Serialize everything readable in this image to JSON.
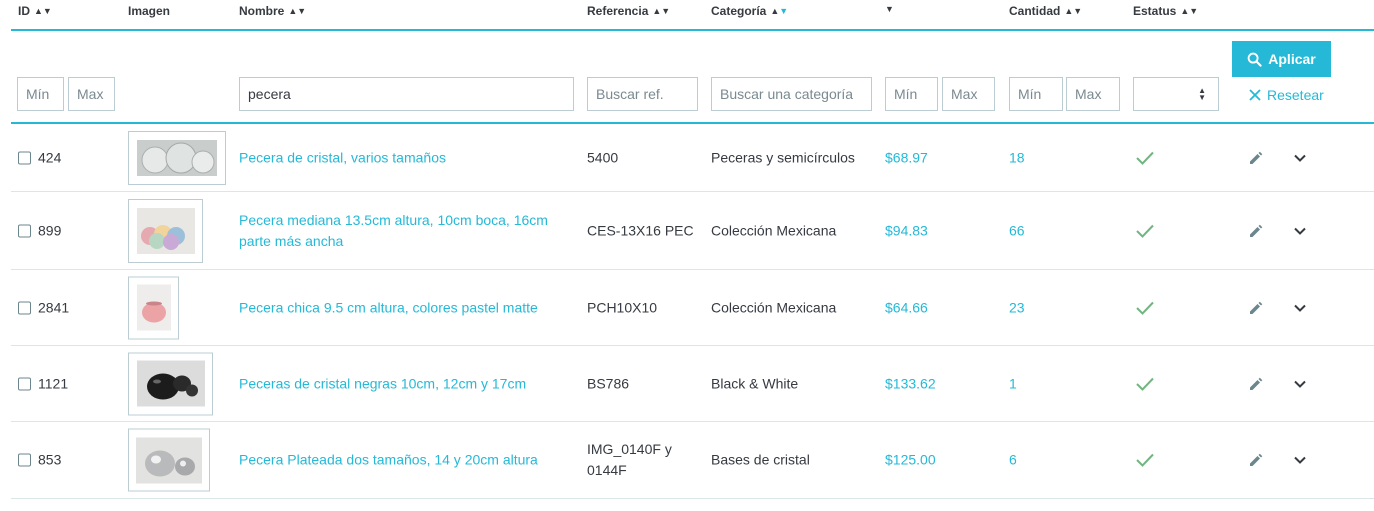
{
  "columns": {
    "id": "ID",
    "image": "Imagen",
    "name": "Nombre",
    "reference": "Referencia",
    "category": "Categoría",
    "price": "",
    "quantity": "Cantidad",
    "status": "Estatus"
  },
  "sort_glyph_up": "▲",
  "sort_glyph_down": "▼",
  "filters": {
    "id_min_placeholder": "Mín",
    "id_max_placeholder": "Max",
    "name_value": "pecera",
    "reference_placeholder": "Buscar ref.",
    "category_placeholder": "Buscar una categoría",
    "price_min_placeholder": "Mín",
    "price_max_placeholder": "Max",
    "qty_min_placeholder": "Mín",
    "qty_max_placeholder": "Max",
    "status_value": ""
  },
  "actions": {
    "apply_label": "Aplicar",
    "reset_label": "Resetear"
  },
  "colors": {
    "accent": "#25b9d7",
    "success": "#70b580",
    "text": "#363a41"
  },
  "rows": [
    {
      "id": "424",
      "name": "Pecera de cristal, varios tamaños",
      "reference": "5400",
      "category": "Peceras y semicírculos",
      "price": "$68.97",
      "quantity": "18",
      "status_icon": "check-icon"
    },
    {
      "id": "899",
      "name": "Pecera mediana 13.5cm altura, 10cm boca, 16cm parte más ancha",
      "reference": "CES-13X16 PEC",
      "category": "Colección Mexicana",
      "price": "$94.83",
      "quantity": "66",
      "status_icon": "check-icon"
    },
    {
      "id": "2841",
      "name": "Pecera chica 9.5 cm altura, colores pastel matte",
      "reference": "PCH10X10",
      "category": "Colección Mexicana",
      "price": "$64.66",
      "quantity": "23",
      "status_icon": "check-icon"
    },
    {
      "id": "1121",
      "name": "Peceras de cristal negras 10cm, 12cm y 17cm",
      "reference": "BS786",
      "category": "Black & White",
      "price": "$133.62",
      "quantity": "1",
      "status_icon": "check-icon"
    },
    {
      "id": "853",
      "name": "Pecera Plateada dos tamaños, 14 y 20cm altura",
      "reference": "IMG_0140F y 0144F",
      "category": "Bases de cristal",
      "price": "$125.00",
      "quantity": "6",
      "status_icon": "check-icon"
    }
  ]
}
